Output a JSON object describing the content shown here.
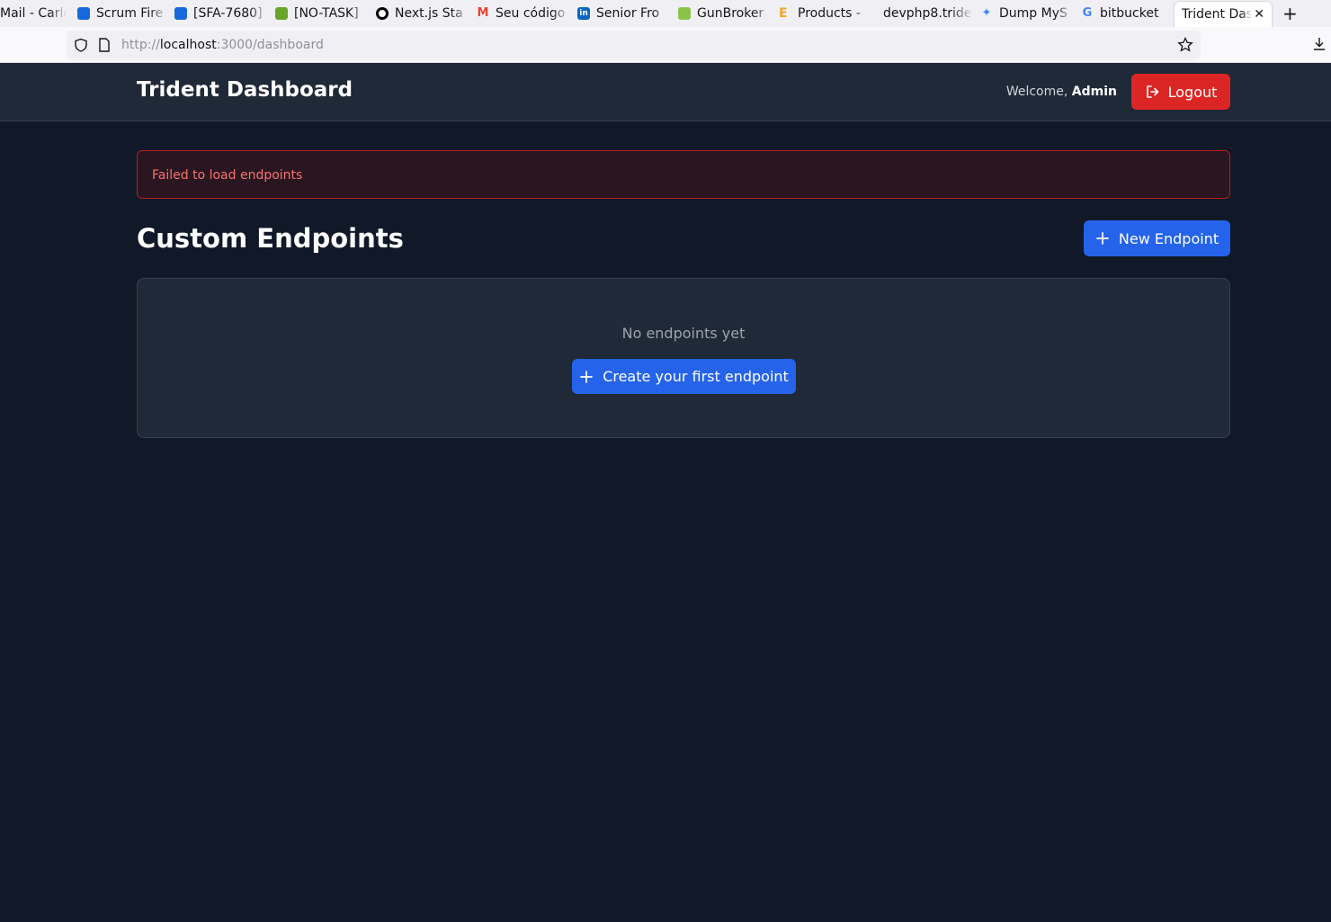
{
  "browser": {
    "tabs": [
      {
        "label": "Mail - Carlos"
      },
      {
        "label": "Scrum Fire"
      },
      {
        "label": "[SFA-7680]"
      },
      {
        "label": "[NO-TASK]"
      },
      {
        "label": "Next.js Sta"
      },
      {
        "label": "Seu código"
      },
      {
        "label": "Senior Fro"
      },
      {
        "label": "GunBroker"
      },
      {
        "label": "Products -"
      },
      {
        "label": "devphp8.tride"
      },
      {
        "label": "Dump MyS"
      },
      {
        "label": "bitbucket"
      },
      {
        "label": "Trident Das"
      }
    ],
    "url": {
      "prefix": "http://",
      "host": "localhost",
      "rest": ":3000/dashboard"
    }
  },
  "header": {
    "brand": "Trident Dashboard",
    "welcome_prefix": "Welcome,",
    "username": "Admin",
    "logout_label": "Logout"
  },
  "alert": {
    "message": "Failed to load endpoints"
  },
  "main": {
    "title": "Custom Endpoints",
    "new_button_label": "New Endpoint",
    "empty_text": "No endpoints yet",
    "create_button_label": "Create your first endpoint"
  },
  "colors": {
    "background": "#111827",
    "surface": "#1f2937",
    "primary": "#2563eb",
    "danger": "#dc2626",
    "error_text": "#f87171"
  }
}
